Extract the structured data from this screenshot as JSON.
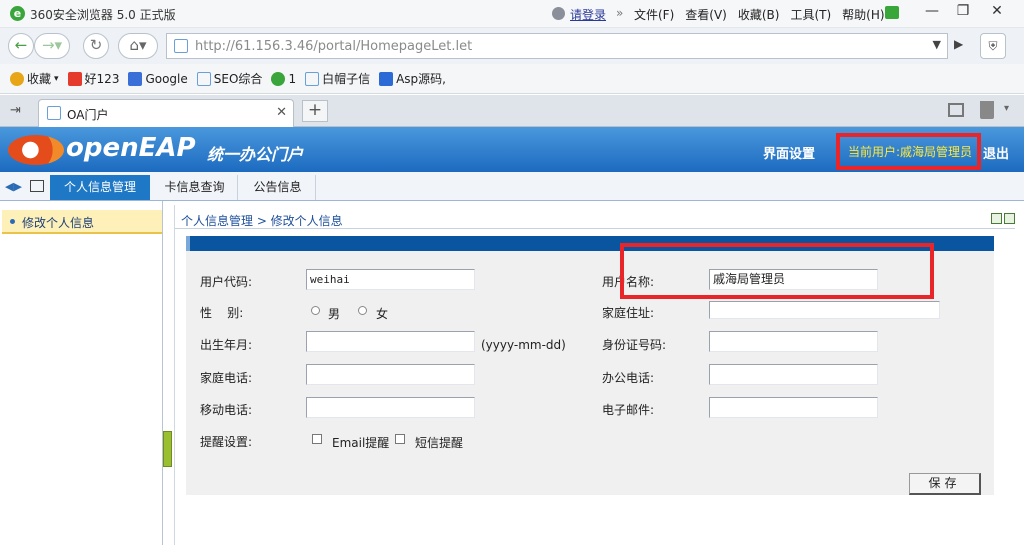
{
  "browser": {
    "title": "360安全浏览器 5.0 正式版",
    "login": "请登录",
    "menus": [
      "文件(F)",
      "查看(V)",
      "收藏(B)",
      "工具(T)",
      "帮助(H)"
    ],
    "url": "http://61.156.3.46/portal/HomepageLet.let",
    "bookmarks": [
      {
        "label": "收藏",
        "icon": "star-icon",
        "color": "#e8a617"
      },
      {
        "label": "好123",
        "icon": "hao123-icon",
        "color": "#e53b2c"
      },
      {
        "label": "Google",
        "icon": "google-icon",
        "color": "#3b6fd8"
      },
      {
        "label": "SEO综合",
        "icon": "page-icon",
        "color": "#6aa0d8"
      },
      {
        "label": "1",
        "icon": "user-icon",
        "color": "#3aa53a"
      },
      {
        "label": "白帽子信",
        "icon": "page-icon",
        "color": "#6aa0d8"
      },
      {
        "label": "Asp源码,",
        "icon": "asp-icon",
        "color": "#2c6bd6"
      }
    ],
    "tab_title": "OA门户"
  },
  "app": {
    "logo": "openEAP",
    "portal_title": "统一办公门户",
    "ui_settings": "界面设置",
    "current_user": "当前用户:戚海局管理员",
    "logout": "退出",
    "accent_color": "#1e78c6",
    "highlight_color": "#e8262a"
  },
  "module_nav": [
    "个人信息管理",
    "卡信息查询",
    "公告信息"
  ],
  "sidebar": {
    "items": [
      "修改个人信息"
    ]
  },
  "breadcrumb": "个人信息管理 > 修改个人信息",
  "form": {
    "user_code_label": "用户代码:",
    "user_code_value": "weihai",
    "user_name_label": "用户名称:",
    "user_name_value": "戚海局管理员",
    "gender_label": "性    别:",
    "gender_male": "男",
    "gender_female": "女",
    "home_address_label": "家庭住址:",
    "home_address_value": "",
    "birth_label": "出生年月:",
    "birth_value": "",
    "birth_hint": "(yyyy-mm-dd)",
    "id_card_label": "身份证号码:",
    "id_card_value": "",
    "home_phone_label": "家庭电话:",
    "home_phone_value": "",
    "office_phone_label": "办公电话:",
    "office_phone_value": "",
    "mobile_label": "移动电话:",
    "mobile_value": "",
    "email_label": "电子邮件:",
    "email_value": "",
    "reminder_label": "提醒设置:",
    "email_reminder": "Email提醒",
    "sms_reminder": "短信提醒",
    "save_label": "保存"
  }
}
